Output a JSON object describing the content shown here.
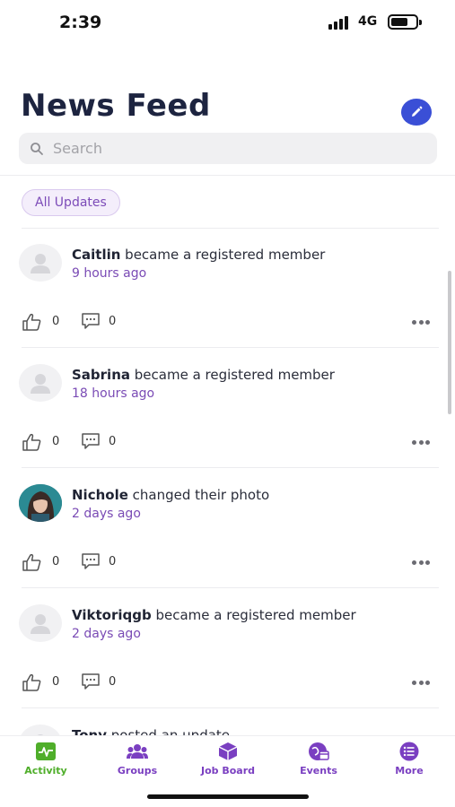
{
  "status_bar": {
    "time": "2:39",
    "network": "4G"
  },
  "header": {
    "title": "News Feed",
    "compose_icon": "pencil-icon"
  },
  "search": {
    "placeholder": "Search",
    "value": ""
  },
  "filter": {
    "label": "All Updates"
  },
  "feed": [
    {
      "name": "Caitlin",
      "action": " became a registered member",
      "time": "9 hours ago",
      "likes": "0",
      "comments": "0",
      "avatar": "default-avatar"
    },
    {
      "name": "Sabrina",
      "action": " became a registered member",
      "time": "18 hours ago",
      "likes": "0",
      "comments": "0",
      "avatar": "default-avatar"
    },
    {
      "name": "Nichole",
      "action": " changed their photo",
      "time": "2 days ago",
      "likes": "0",
      "comments": "0",
      "avatar": "photo-avatar"
    },
    {
      "name": "Viktoriqgb",
      "action": " became a registered member",
      "time": "2 days ago",
      "likes": "0",
      "comments": "0",
      "avatar": "default-avatar"
    },
    {
      "name": "Tony",
      "action": " posted an update",
      "time": "",
      "likes": "",
      "comments": "",
      "avatar": "default-avatar"
    }
  ],
  "tabs": [
    {
      "label": "Activity",
      "icon": "activity-icon",
      "active": true
    },
    {
      "label": "Groups",
      "icon": "groups-icon",
      "active": false
    },
    {
      "label": "Job Board",
      "icon": "job-board-icon",
      "active": false
    },
    {
      "label": "Events",
      "icon": "events-icon",
      "active": false
    },
    {
      "label": "More",
      "icon": "more-list-icon",
      "active": false
    }
  ],
  "colors": {
    "accent": "#7a4bb5",
    "active_tab": "#4fae2a",
    "compose_button": "#3a4fd6",
    "title": "#1d2440"
  }
}
